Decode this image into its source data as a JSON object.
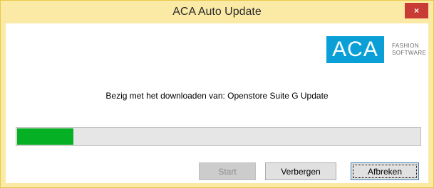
{
  "window": {
    "title": "ACA Auto Update",
    "close_label": "×"
  },
  "logo": {
    "main": "ACA",
    "line1": "FASHION",
    "line2": "SOFTWARE"
  },
  "status_text": "Bezig met het downloaden van: Openstore Suite G Update",
  "progress": {
    "fraction": 0.14,
    "color": "#06b025"
  },
  "buttons": {
    "start": "Start",
    "hide": "Verbergen",
    "cancel": "Afbreken"
  }
}
